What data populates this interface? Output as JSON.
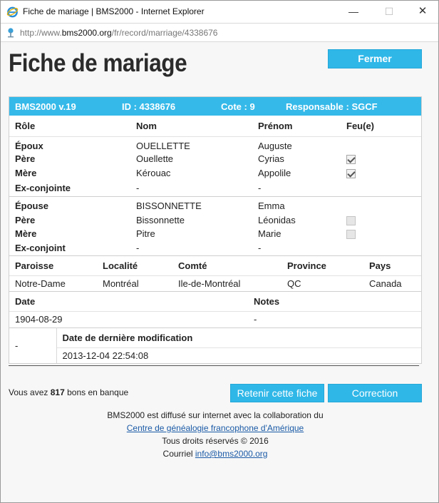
{
  "window": {
    "title": "Fiche de mariage | BMS2000 - Internet Explorer",
    "url_prefix": "http://www.",
    "url_host": "bms2000.org",
    "url_path": "/fr/record/marriage/4338676"
  },
  "page": {
    "title": "Fiche de mariage",
    "close_label": "Fermer"
  },
  "record_header": {
    "version": "BMS2000 v.19",
    "id": "ID : 4338676",
    "cote": "Cote : 9",
    "responsable": "Responsable : SGCF"
  },
  "persons_headers": {
    "role": "Rôle",
    "nom": "Nom",
    "prenom": "Prénom",
    "feu": "Feu(e)"
  },
  "groom_group": [
    {
      "role": "Époux",
      "nom": "OUELLETTE",
      "prenom": "Auguste",
      "feu": null
    },
    {
      "role": "Père",
      "nom": "Ouellette",
      "prenom": "Cyrias",
      "feu": true
    },
    {
      "role": "Mère",
      "nom": "Kérouac",
      "prenom": "Appolile",
      "feu": true
    },
    {
      "role": "Ex-conjointe",
      "nom": "-",
      "prenom": "-",
      "feu": null
    }
  ],
  "bride_group": [
    {
      "role": "Épouse",
      "nom": "BISSONNETTE",
      "prenom": "Emma",
      "feu": null
    },
    {
      "role": "Père",
      "nom": "Bissonnette",
      "prenom": "Léonidas",
      "feu": false
    },
    {
      "role": "Mère",
      "nom": "Pitre",
      "prenom": "Marie",
      "feu": false
    },
    {
      "role": "Ex-conjoint",
      "nom": "-",
      "prenom": "-",
      "feu": null
    }
  ],
  "place_headers": {
    "paroisse": "Paroisse",
    "localite": "Localité",
    "comte": "Comté",
    "province": "Province",
    "pays": "Pays"
  },
  "place": {
    "paroisse": "Notre-Dame",
    "localite": "Montréal",
    "comte": "Ile-de-Montréal",
    "province": "QC",
    "pays": "Canada"
  },
  "date_headers": {
    "date": "Date",
    "notes": "Notes"
  },
  "date_values": {
    "date": "1904-08-29",
    "notes": "-"
  },
  "modification": {
    "left_value": "-",
    "label": "Date de dernière modification",
    "value": "2013-12-04 22:54:08"
  },
  "credit": {
    "prefix": "Vous avez",
    "amount": "817",
    "suffix": "bons en banque"
  },
  "actions": {
    "keep_label": "Retenir cette fiche",
    "correction_label": "Correction"
  },
  "footer": {
    "line1": "BMS2000 est diffusé sur internet avec la collaboration du",
    "link1": "Centre de généalogie francophone d'Amérique",
    "line3": "Tous droits réservés © 2016",
    "line4_prefix": "Courriel",
    "email": "info@bms2000.org"
  },
  "colors": {
    "accent": "#35b9e9",
    "link": "#1a5aa6"
  }
}
